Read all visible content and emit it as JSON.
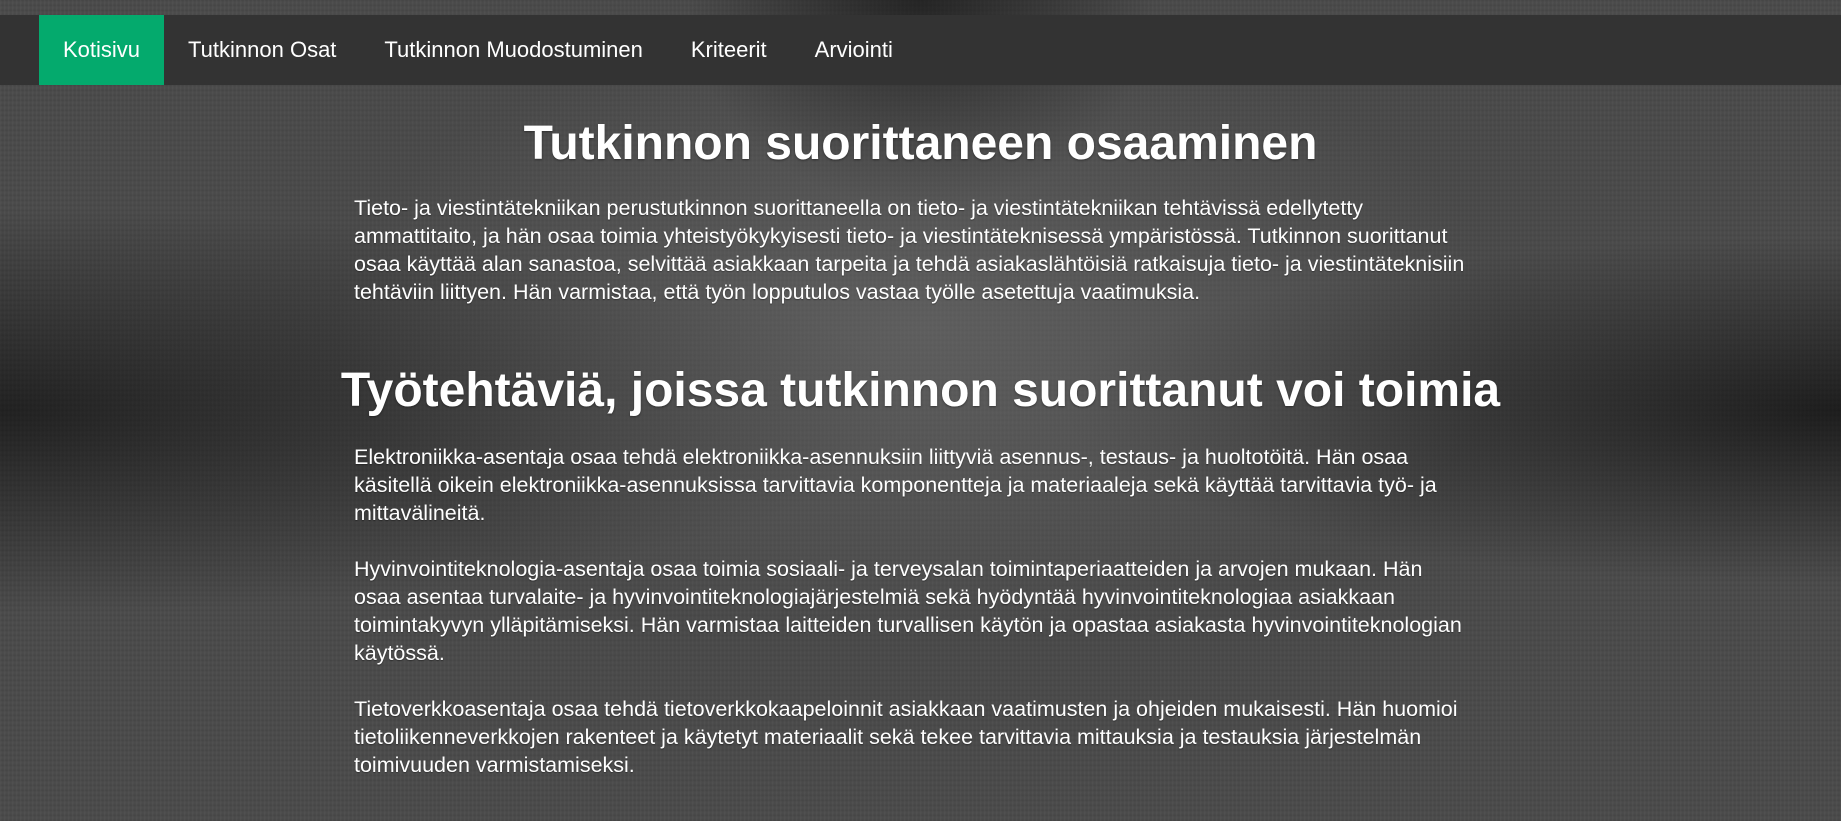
{
  "nav": {
    "items": [
      {
        "label": "Kotisivu",
        "active": true
      },
      {
        "label": "Tutkinnon Osat",
        "active": false
      },
      {
        "label": "Tutkinnon Muodostuminen",
        "active": false
      },
      {
        "label": "Kriteerit",
        "active": false
      },
      {
        "label": "Arviointi",
        "active": false
      }
    ],
    "active_color": "#04aa6d",
    "bar_color": "#333333"
  },
  "sections": {
    "competence": {
      "heading": "Tutkinnon suorittaneen osaaminen",
      "text": "Tieto- ja viestintätekniikan perustutkinnon suorittaneella on tieto- ja viestintätekniikan tehtävissä edellytetty ammattitaito, ja hän osaa toimia yhteistyökykyisesti tieto- ja viestintäteknisessä ympäristössä. Tutkinnon suorittanut osaa käyttää alan sanastoa, selvittää asiakkaan tarpeita ja tehdä asiakaslähtöisiä ratkaisuja tieto- ja viestintäteknisiin tehtäviin liittyen. Hän varmistaa, että työn lopputulos vastaa työlle asetettuja vaatimuksia."
    },
    "tasks": {
      "heading": "Työtehtäviä, joissa tutkinnon suorittanut voi toimia",
      "paragraphs": [
        "Elektroniikka-asentaja osaa tehdä elektroniikka-asennuksiin liittyviä asennus-, testaus- ja huoltotöitä. Hän osaa käsitellä oikein elektroniikka-asennuksissa tarvittavia komponentteja ja materiaaleja sekä käyttää tarvittavia työ- ja mittavälineitä.",
        "Hyvinvointiteknologia-asentaja osaa toimia sosiaali- ja terveysalan toimintaperiaatteiden ja arvojen mukaan. Hän osaa asentaa turvalaite- ja hyvinvointiteknologiajärjestelmiä sekä hyödyntää hyvinvointiteknologiaa asiakkaan toimintakyvyn ylläpitämiseksi. Hän varmistaa laitteiden turvallisen käytön ja opastaa asiakasta hyvinvointiteknologian käytössä.",
        "Tietoverkkoasentaja osaa tehdä tietoverkkokaapeloinnit asiakkaan vaatimusten ja ohjeiden mukaisesti. Hän huomioi tietoliikenneverkkojen rakenteet ja käytetyt materiaalit sekä tekee tarvittavia mittauksia ja testauksia järjestelmän toimivuuden varmistamiseksi."
      ]
    }
  }
}
